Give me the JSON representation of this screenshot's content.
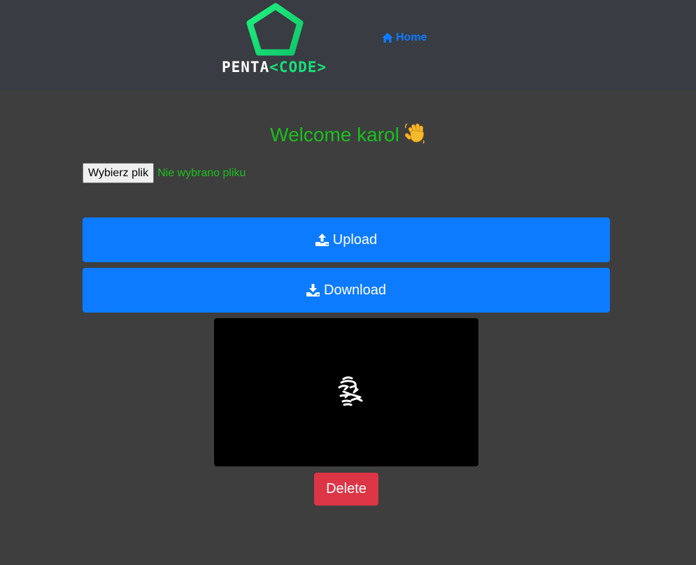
{
  "header": {
    "logo": {
      "text_white": "PENTA",
      "text_green": "<CODE>",
      "icon": "pentagon-logo-icon"
    },
    "nav": {
      "home_label": "Home",
      "home_icon": "home-icon"
    }
  },
  "main": {
    "welcome_text": "Welcome karol",
    "welcome_emoji": "waving-hand-icon",
    "file_input": {
      "button_label": "Wybierz plik",
      "status_text": "Nie wybrano pliku"
    },
    "upload_label": "Upload",
    "upload_icon": "upload-icon",
    "download_label": "Download",
    "download_icon": "download-icon",
    "preview_alt": "uploaded-image-preview",
    "delete_label": "Delete"
  },
  "colors": {
    "navbar": "#393c42",
    "background": "#3e3e3e",
    "accent_green": "#19c11d",
    "logo_green": "#18e07a",
    "primary_blue": "#0d7bff",
    "danger_red": "#dc3545"
  }
}
